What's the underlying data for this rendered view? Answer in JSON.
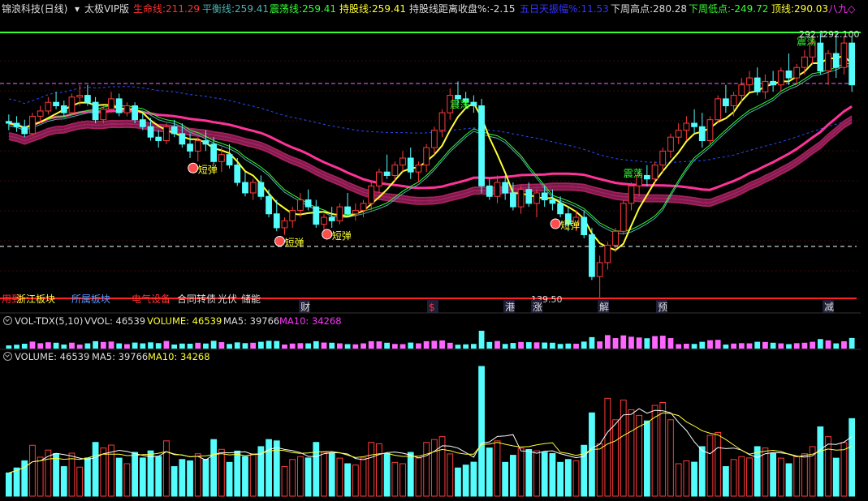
{
  "title_bar": {
    "stock_name": "锦浪科技(日线)",
    "indicator_name": "太极VIP版",
    "items": [
      {
        "label": "生命线:",
        "value": "211.29",
        "color": "#ff3030"
      },
      {
        "label": "平衡线:",
        "value": "259.41",
        "color": "#4fb3b3"
      },
      {
        "label": "震荡线:",
        "value": "259.41",
        "color": "#33ff33"
      },
      {
        "label": "持股线:",
        "value": "259.41",
        "color": "#ffff33"
      },
      {
        "label": "持股线距离收盘%:",
        "value": "-2.15",
        "color": "#dddddd"
      },
      {
        "label": "五日天振幅%:",
        "value": "11.53",
        "color": "#3333ff"
      },
      {
        "label": "下周高点:",
        "value": "280.28",
        "color": "#dddddd"
      },
      {
        "label": "下周低点:",
        "value": "-249.72",
        "color": "#33ff33"
      },
      {
        "label": "顶线:",
        "value": "290.03",
        "color": "#ffff33"
      }
    ],
    "tail_text": "八九◇"
  },
  "price_panel": {
    "high_label": "292.1",
    "high_label_2": "292.100",
    "low_label": "139.50",
    "signal_labels": [
      "震荡",
      "短弹",
      "短弹",
      "短弹",
      "短弹",
      "震荡",
      "震荡"
    ],
    "event_markers": [
      "财",
      "$",
      "港",
      "涨",
      "解",
      "预",
      "减"
    ],
    "sector_bar": [
      "用到",
      "浙江板块",
      "所属板块",
      "电气设备",
      "合同转债",
      "光伏",
      "储能"
    ]
  },
  "vol_tdx_header": {
    "name": "VOL-TDX(5,10)",
    "vvol": "VVOL: 46539",
    "volume": "VOLUME: 46539",
    "ma5": "MA5: 39766",
    "ma10": "MA10: 34268"
  },
  "volume_header": {
    "volume": "VOLUME: 46539",
    "ma5": "MA5: 39766",
    "ma10": "MA10: 34268"
  },
  "chart_data": {
    "type": "candlestick",
    "price_range": [
      139.5,
      292.1
    ],
    "candles": [
      [
        241,
        245,
        236,
        240
      ],
      [
        240,
        244,
        235,
        238
      ],
      [
        238,
        242,
        232,
        234
      ],
      [
        234,
        246,
        233,
        244
      ],
      [
        244,
        250,
        240,
        247
      ],
      [
        247,
        255,
        245,
        252
      ],
      [
        252,
        258,
        248,
        250
      ],
      [
        250,
        253,
        244,
        246
      ],
      [
        246,
        257,
        245,
        255
      ],
      [
        255,
        262,
        250,
        256
      ],
      [
        256,
        262,
        250,
        252
      ],
      [
        252,
        255,
        240,
        242
      ],
      [
        242,
        250,
        240,
        248
      ],
      [
        248,
        258,
        246,
        254
      ],
      [
        254,
        257,
        244,
        246
      ],
      [
        246,
        252,
        244,
        250
      ],
      [
        250,
        252,
        240,
        242
      ],
      [
        242,
        246,
        236,
        238
      ],
      [
        238,
        243,
        230,
        232
      ],
      [
        232,
        236,
        226,
        230
      ],
      [
        230,
        240,
        228,
        238
      ],
      [
        238,
        242,
        232,
        234
      ],
      [
        234,
        240,
        226,
        228
      ],
      [
        228,
        234,
        220,
        224
      ],
      [
        224,
        232,
        218,
        230
      ],
      [
        230,
        236,
        224,
        228
      ],
      [
        228,
        232,
        216,
        218
      ],
      [
        218,
        226,
        212,
        222
      ],
      [
        222,
        228,
        214,
        216
      ],
      [
        216,
        220,
        204,
        206
      ],
      [
        206,
        212,
        198,
        200
      ],
      [
        200,
        208,
        196,
        206
      ],
      [
        206,
        210,
        196,
        198
      ],
      [
        198,
        202,
        186,
        188
      ],
      [
        188,
        196,
        178,
        180
      ],
      [
        180,
        186,
        176,
        184
      ],
      [
        184,
        192,
        180,
        190
      ],
      [
        190,
        200,
        186,
        196
      ],
      [
        196,
        202,
        190,
        192
      ],
      [
        192,
        196,
        180,
        182
      ],
      [
        182,
        188,
        176,
        186
      ],
      [
        186,
        192,
        180,
        184
      ],
      [
        184,
        194,
        182,
        192
      ],
      [
        192,
        200,
        186,
        188
      ],
      [
        188,
        194,
        184,
        190
      ],
      [
        190,
        196,
        186,
        194
      ],
      [
        194,
        206,
        190,
        204
      ],
      [
        204,
        214,
        200,
        212
      ],
      [
        212,
        222,
        208,
        210
      ],
      [
        210,
        218,
        206,
        216
      ],
      [
        216,
        224,
        212,
        220
      ],
      [
        220,
        226,
        208,
        212
      ],
      [
        212,
        218,
        206,
        216
      ],
      [
        216,
        228,
        212,
        226
      ],
      [
        226,
        238,
        222,
        236
      ],
      [
        236,
        248,
        232,
        246
      ],
      [
        246,
        260,
        242,
        256
      ],
      [
        256,
        264,
        250,
        254
      ],
      [
        254,
        258,
        248,
        252
      ],
      [
        252,
        256,
        246,
        250
      ],
      [
        250,
        254,
        200,
        204
      ],
      [
        204,
        208,
        196,
        198
      ],
      [
        198,
        210,
        194,
        206
      ],
      [
        206,
        210,
        196,
        200
      ],
      [
        200,
        206,
        190,
        192
      ],
      [
        192,
        204,
        188,
        202
      ],
      [
        202,
        206,
        192,
        194
      ],
      [
        194,
        202,
        186,
        200
      ],
      [
        200,
        204,
        192,
        196
      ],
      [
        196,
        202,
        190,
        194
      ],
      [
        194,
        198,
        186,
        188
      ],
      [
        188,
        192,
        178,
        182
      ],
      [
        182,
        190,
        178,
        186
      ],
      [
        186,
        190,
        174,
        176
      ],
      [
        176,
        180,
        150,
        152
      ],
      [
        152,
        164,
        140,
        160
      ],
      [
        160,
        172,
        156,
        170
      ],
      [
        170,
        180,
        166,
        178
      ],
      [
        178,
        196,
        176,
        194
      ],
      [
        194,
        206,
        190,
        204
      ],
      [
        204,
        212,
        198,
        210
      ],
      [
        210,
        216,
        204,
        208
      ],
      [
        208,
        218,
        206,
        216
      ],
      [
        216,
        226,
        212,
        224
      ],
      [
        224,
        234,
        220,
        232
      ],
      [
        232,
        240,
        228,
        236
      ],
      [
        236,
        244,
        230,
        240
      ],
      [
        240,
        248,
        234,
        238
      ],
      [
        238,
        246,
        226,
        230
      ],
      [
        230,
        244,
        228,
        242
      ],
      [
        242,
        256,
        240,
        254
      ],
      [
        254,
        262,
        246,
        250
      ],
      [
        250,
        258,
        244,
        256
      ],
      [
        256,
        266,
        252,
        262
      ],
      [
        262,
        270,
        258,
        266
      ],
      [
        266,
        272,
        256,
        258
      ],
      [
        258,
        268,
        254,
        264
      ],
      [
        264,
        270,
        258,
        262
      ],
      [
        262,
        272,
        258,
        270
      ],
      [
        270,
        280,
        262,
        266
      ],
      [
        266,
        274,
        262,
        272
      ],
      [
        272,
        282,
        268,
        278
      ],
      [
        278,
        290,
        274,
        286
      ],
      [
        286,
        292,
        268,
        270
      ],
      [
        270,
        282,
        262,
        280
      ],
      [
        280,
        292,
        266,
        272
      ],
      [
        272,
        290,
        268,
        286
      ],
      [
        286,
        290,
        258,
        262
      ]
    ]
  },
  "colors": {
    "up": "#ff3b3b",
    "down": "#54fcfc",
    "lifeline": "#ff3399",
    "balance": "#4fb3b3",
    "yellow": "#ffff33",
    "green": "#33ff33",
    "magenta": "#ff33ff",
    "blue_dash": "#2a4cff",
    "purple_dash": "#ff66ff",
    "white": "#ffffff",
    "red_line": "#ff2020"
  }
}
